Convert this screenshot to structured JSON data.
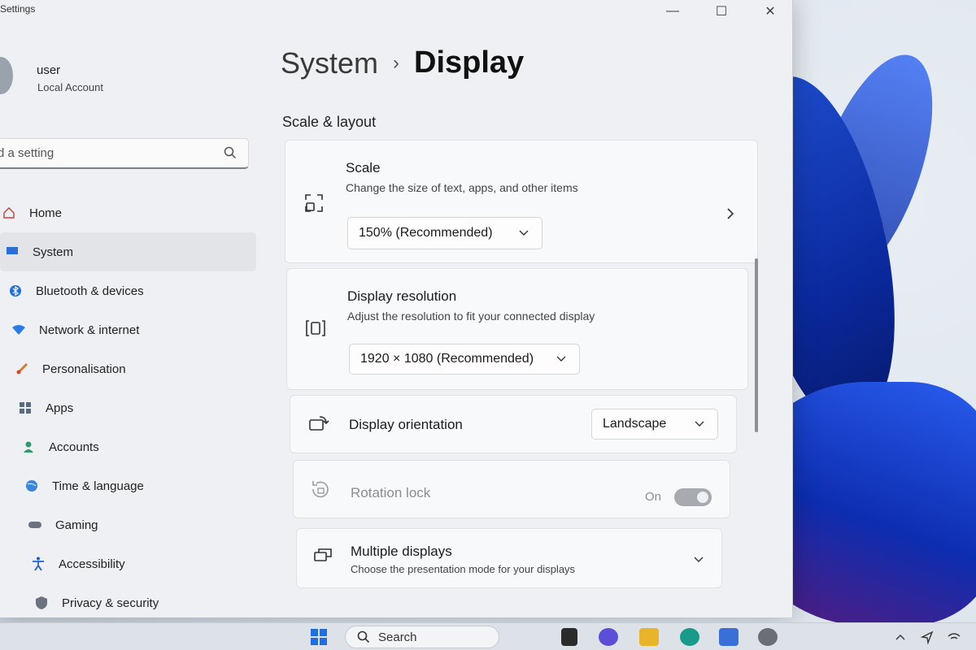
{
  "window": {
    "app_title": "Settings",
    "controls": {
      "minimize": "—",
      "maximize": "☐",
      "close": "✕"
    }
  },
  "user": {
    "name": "user",
    "account_type": "Local Account"
  },
  "search": {
    "placeholder": "Find a setting",
    "value": "d a setting"
  },
  "sidebar": {
    "items": [
      {
        "label": "Home",
        "icon": "home-icon",
        "active": false
      },
      {
        "label": "System",
        "icon": "system-icon",
        "active": true
      },
      {
        "label": "Bluetooth & devices",
        "icon": "bluetooth-icon",
        "active": false
      },
      {
        "label": "Network & internet",
        "icon": "network-icon",
        "active": false
      },
      {
        "label": "Personalisation",
        "icon": "brush-icon",
        "active": false
      },
      {
        "label": "Apps",
        "icon": "apps-icon",
        "active": false
      },
      {
        "label": "Accounts",
        "icon": "person-icon",
        "active": false
      },
      {
        "label": "Time & language",
        "icon": "globe-icon",
        "active": false
      },
      {
        "label": "Gaming",
        "icon": "gamepad-icon",
        "active": false
      },
      {
        "label": "Accessibility",
        "icon": "accessibility-icon",
        "active": false
      },
      {
        "label": "Privacy & security",
        "icon": "shield-icon",
        "active": false
      }
    ]
  },
  "breadcrumb": {
    "parent": "System",
    "separator": "›",
    "current": "Display"
  },
  "section": {
    "title": "Scale & layout"
  },
  "cards": {
    "scale": {
      "title": "Scale",
      "description": "Change the size of text, apps, and other items",
      "value": "150% (Recommended)"
    },
    "resolution": {
      "title": "Display resolution",
      "description": "Adjust the resolution to fit your connected display",
      "value": "1920 × 1080 (Recommended)"
    },
    "orientation": {
      "title": "Display orientation",
      "value": "Landscape"
    },
    "rotation_lock": {
      "title": "Rotation lock",
      "state_label": "On",
      "enabled": false
    },
    "multiple_displays": {
      "title": "Multiple displays",
      "description": "Choose the presentation mode for your displays"
    }
  },
  "taskbar": {
    "search_label": "Search"
  },
  "colors": {
    "accent": "#0f4ccf",
    "window_bg": "#eef0f3",
    "card_bg": "#f8f9fa"
  }
}
